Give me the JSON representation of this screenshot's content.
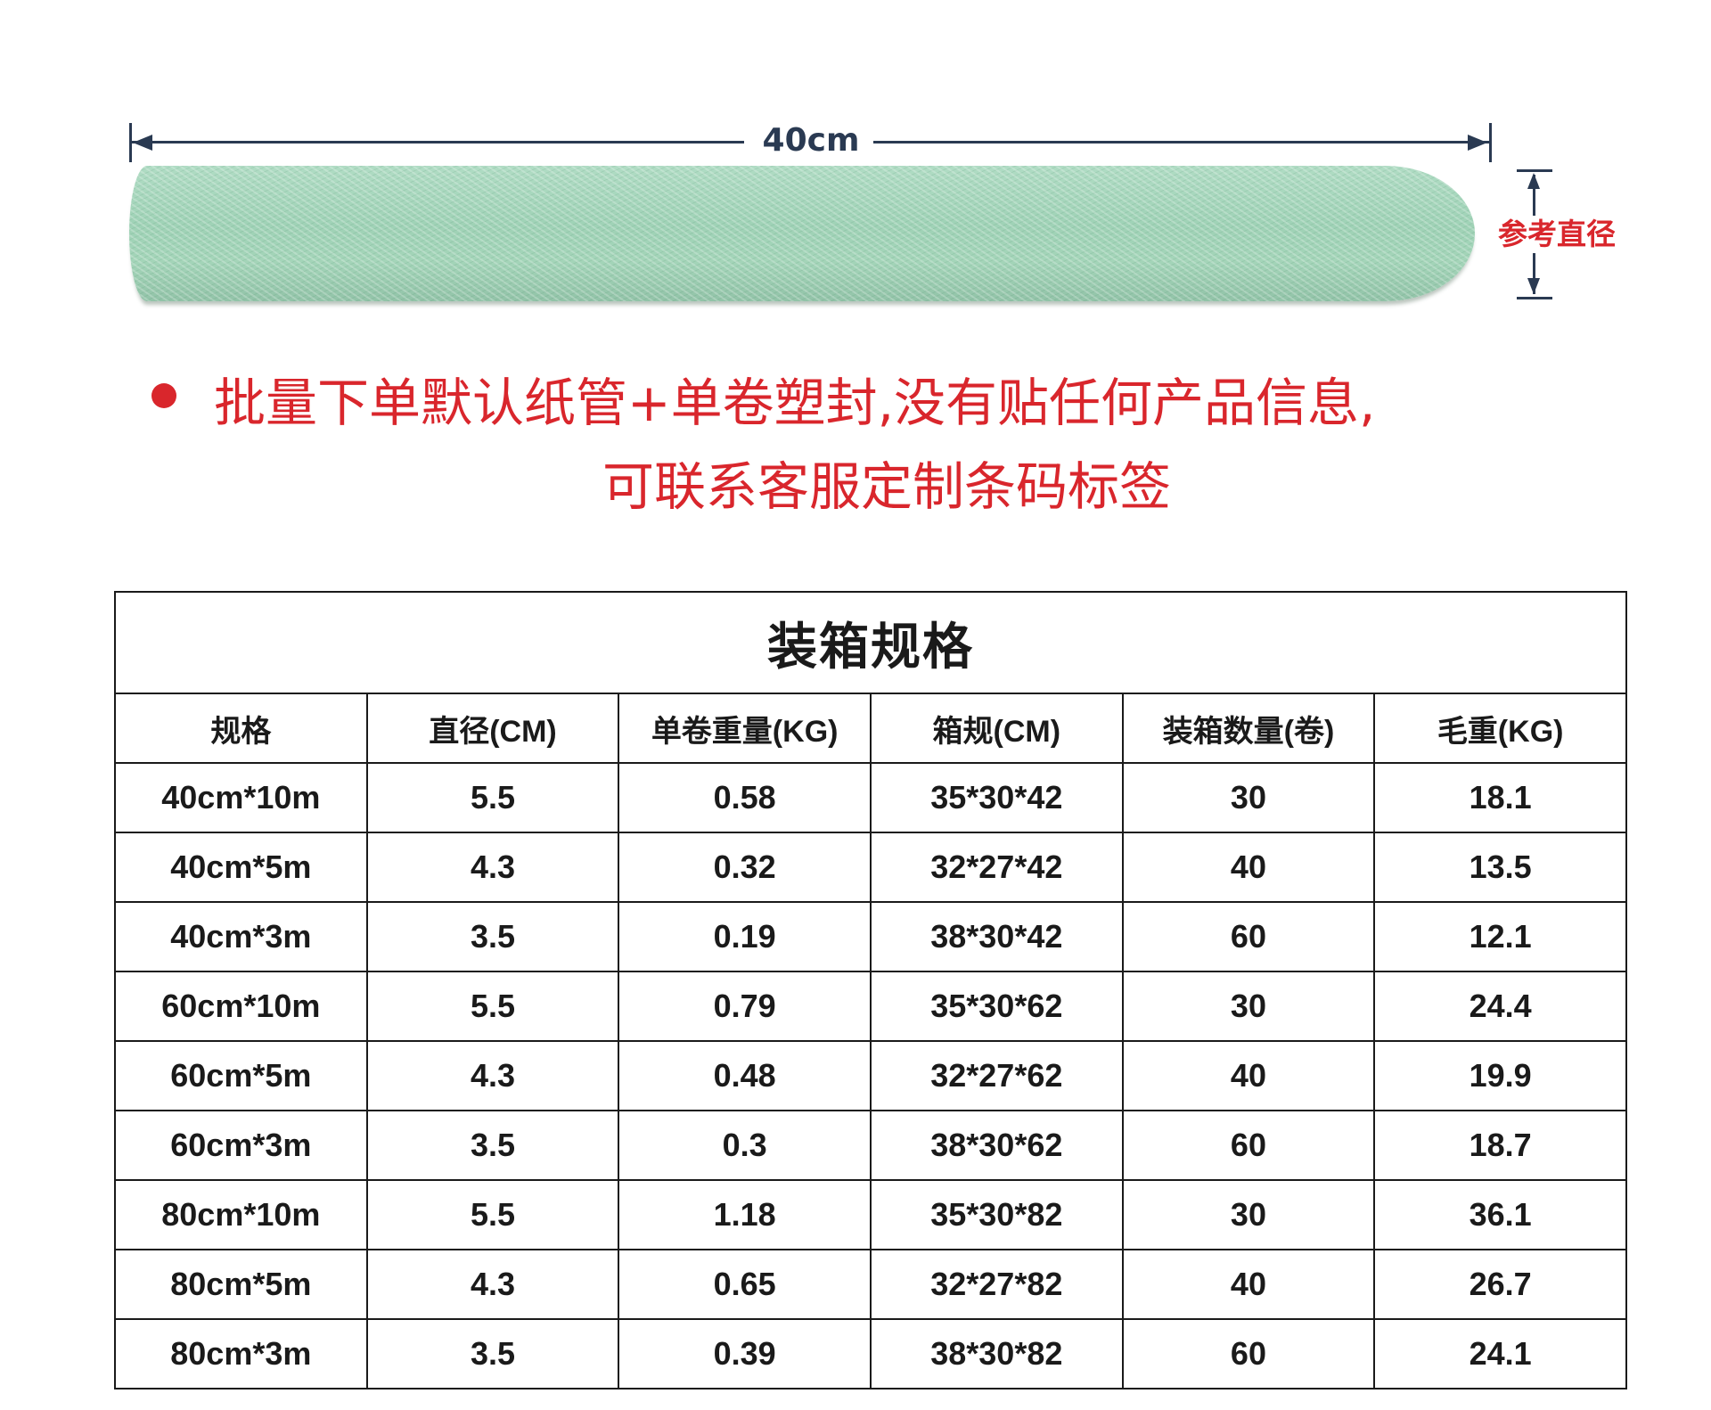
{
  "diagram": {
    "length_label": "40cm",
    "diameter_label": "参考直径"
  },
  "notice": {
    "line1": "批量下单默认纸管+单卷塑封,没有贴任何产品信息,",
    "line2": "可联系客服定制条码标签",
    "color": "#d9262c"
  },
  "table": {
    "title": "装箱规格",
    "headers": [
      "规格",
      "直径(CM)",
      "单卷重量(KG)",
      "箱规(CM)",
      "装箱数量(卷)",
      "毛重(KG)"
    ],
    "rows": [
      [
        "40cm*10m",
        "5.5",
        "0.58",
        "35*30*42",
        "30",
        "18.1"
      ],
      [
        "40cm*5m",
        "4.3",
        "0.32",
        "32*27*42",
        "40",
        "13.5"
      ],
      [
        "40cm*3m",
        "3.5",
        "0.19",
        "38*30*42",
        "60",
        "12.1"
      ],
      [
        "60cm*10m",
        "5.5",
        "0.79",
        "35*30*62",
        "30",
        "24.4"
      ],
      [
        "60cm*5m",
        "4.3",
        "0.48",
        "32*27*62",
        "40",
        "19.9"
      ],
      [
        "60cm*3m",
        "3.5",
        "0.3",
        "38*30*62",
        "60",
        "18.7"
      ],
      [
        "80cm*10m",
        "5.5",
        "1.18",
        "35*30*82",
        "30",
        "36.1"
      ],
      [
        "80cm*5m",
        "4.3",
        "0.65",
        "32*27*82",
        "40",
        "26.7"
      ],
      [
        "80cm*3m",
        "3.5",
        "0.39",
        "38*30*82",
        "60",
        "24.1"
      ]
    ]
  }
}
